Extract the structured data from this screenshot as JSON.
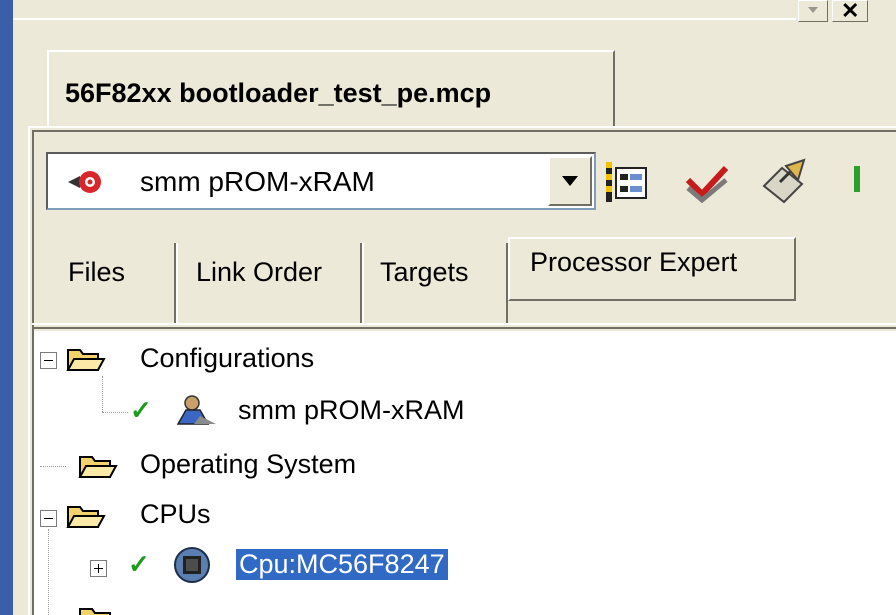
{
  "window": {
    "project_file": "56F82xx bootloader_test_pe.mcp"
  },
  "toolbar": {
    "target_selected": "smm pROM-xRAM",
    "icons": [
      "target-icon",
      "settings-icon",
      "make-icon",
      "debug-icon"
    ]
  },
  "tabs": [
    {
      "label": "Files",
      "active": false
    },
    {
      "label": "Link Order",
      "active": false
    },
    {
      "label": "Targets",
      "active": false
    },
    {
      "label": "Processor Expert",
      "active": true
    }
  ],
  "tree": {
    "configurations": "Configurations",
    "config_item": "smm pROM-xRAM",
    "operating_system": "Operating System",
    "cpus": "CPUs",
    "cpu_item": "Cpu:MC56F8247"
  },
  "colors": {
    "selection": "#316ac5",
    "folder": "#f4d26b",
    "check": "#1c9c1c"
  }
}
